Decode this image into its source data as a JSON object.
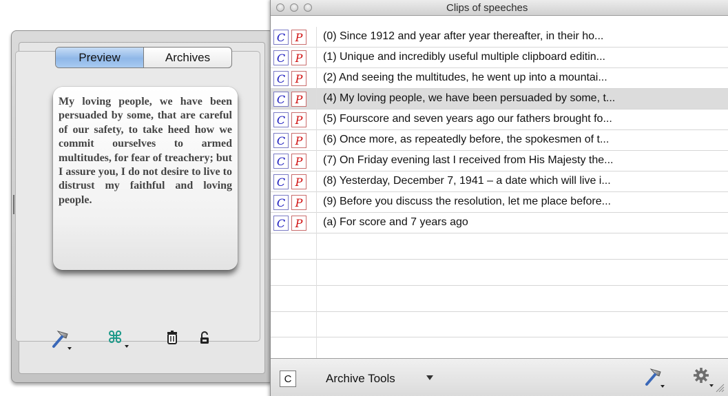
{
  "drawer": {
    "tabs": [
      {
        "label": "Preview",
        "selected": true
      },
      {
        "label": "Archives",
        "selected": false
      }
    ],
    "preview_text": "My loving people, we have been persuaded by some, that are careful of our safety, to take heed how we commit ourselves to armed multitudes, for fear of treachery; but I assure you, I do not desire to live to distrust my faithful and loving people.",
    "toolbar_icons": [
      "hammer-menu-icon",
      "command-key-menu-icon",
      "trash-icon",
      "lock-icon"
    ]
  },
  "window": {
    "title": "Clips of speeches",
    "clips": [
      {
        "copy_label": "C",
        "paste_label": "P",
        "text": "(0)  Since 1912 and year after year thereafter, in their ho..."
      },
      {
        "copy_label": "C",
        "paste_label": "P",
        "text": "(1)  Unique and incredibly useful multiple clipboard editin..."
      },
      {
        "copy_label": "C",
        "paste_label": "P",
        "text": "(2)  And seeing the multitudes, he went up into a mountai..."
      },
      {
        "copy_label": "C",
        "paste_label": "P",
        "text": "(4)  My loving people, we have been persuaded by some, t...",
        "selected": true
      },
      {
        "copy_label": "C",
        "paste_label": "P",
        "text": "(5)  Fourscore and seven years ago our fathers brought fo..."
      },
      {
        "copy_label": "C",
        "paste_label": "P",
        "text": "(6)  Once more, as repeatedly before, the spokesmen of t..."
      },
      {
        "copy_label": "C",
        "paste_label": "P",
        "text": "(7)  On Friday evening last I received from His Majesty the..."
      },
      {
        "copy_label": "C",
        "paste_label": "P",
        "text": "(8)  Yesterday, December 7, 1941 – a date which will live i..."
      },
      {
        "copy_label": "C",
        "paste_label": "P",
        "text": "(9)  Before you discuss the resolution, let me place before..."
      },
      {
        "copy_label": "C",
        "paste_label": "P",
        "text": "(a)  For score and 7 years ago"
      }
    ],
    "bottom_bar": {
      "c_box_label": "C",
      "archive_tools_label": "Archive Tools"
    }
  },
  "colors": {
    "copy_button": "#1b1bbf",
    "paste_button": "#d01010",
    "selected_tab": "#8fb7e8",
    "selected_row": "#dcdcdc"
  }
}
